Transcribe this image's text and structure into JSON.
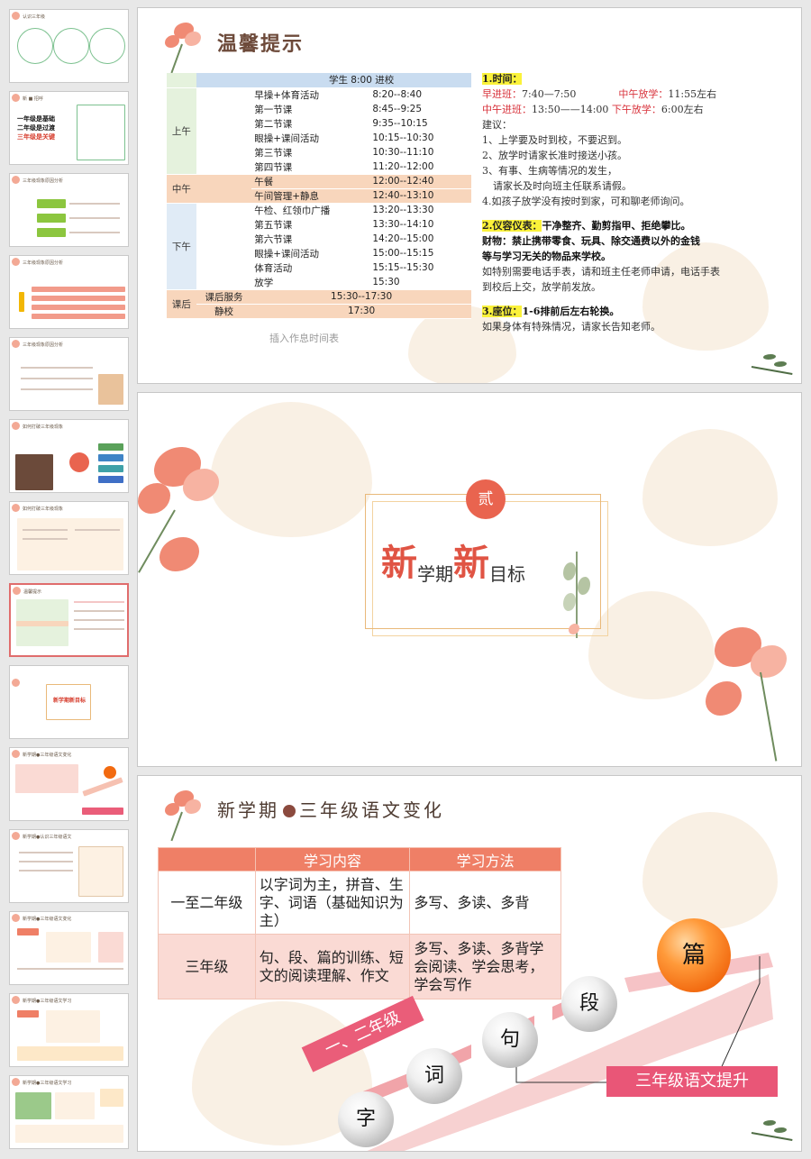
{
  "thumbnails": [
    {
      "title": "认识三年级",
      "lines": [
        "学习方法",
        "三年级的学习特点"
      ]
    },
    {
      "title": "新 ■ 招呼",
      "lines": [
        "一年级是基础",
        "二年级是过渡",
        "三年级是关键"
      ]
    },
    {
      "title": "三年级现象原因分析",
      "lines": [
        "学习内容难度逐渐提升"
      ]
    },
    {
      "title": "三年级现象原因分析",
      "lines": [
        "学习习惯，学习态度懒惰"
      ]
    },
    {
      "title": "三年级现象原因分析",
      "lines": [
        "缺乏兴趣"
      ]
    },
    {
      "title": "如何打破三年级现象",
      "lines": [
        "抓"
      ]
    },
    {
      "title": "如何打破三年级现象",
      "lines": [
        "三个关注"
      ]
    },
    {
      "title": "温馨提示",
      "lines": []
    },
    {
      "title": "",
      "lines": [
        "新学期新目标"
      ]
    },
    {
      "title": "新学期●三年级语文变化",
      "lines": []
    },
    {
      "title": "新学期●认识三年级语文",
      "lines": []
    },
    {
      "title": "新学期●三年级语文变化",
      "lines": []
    },
    {
      "title": "新学期●三年级语文学习",
      "lines": []
    },
    {
      "title": "新学期●三年级语文学习",
      "lines": []
    }
  ],
  "slide1": {
    "title": "温馨提示",
    "schedule_header": "学生 8:00 进校",
    "groups": {
      "am": "上午",
      "noon": "中午",
      "pm": "下午",
      "post": "课后"
    },
    "am_rows": [
      {
        "name": "早操+体育活动",
        "time": "8:20--8:40"
      },
      {
        "name": "第一节课",
        "time": "8:45--9:25"
      },
      {
        "name": "第二节课",
        "time": "9:35--10:15"
      },
      {
        "name": "眼操+课间活动",
        "time": "10:15--10:30"
      },
      {
        "name": "第三节课",
        "time": "10:30--11:10"
      },
      {
        "name": "第四节课",
        "time": "11:20--12:00"
      }
    ],
    "noon_rows": [
      {
        "name": "午餐",
        "time": "12:00--12:40"
      },
      {
        "name": "午间管理+静息",
        "time": "12:40--13:10"
      }
    ],
    "pm_rows": [
      {
        "name": "午检、红领巾广播",
        "time": "13:20--13:30"
      },
      {
        "name": "第五节课",
        "time": "13:30--14:10"
      },
      {
        "name": "第六节课",
        "time": "14:20--15:00"
      },
      {
        "name": "眼操+课间活动",
        "time": "15:00--15:15"
      },
      {
        "name": "体育活动",
        "time": "15:15--15:30"
      },
      {
        "name": "放学",
        "time": "15:30"
      }
    ],
    "post_rows": [
      {
        "name": "课后服务",
        "time": "15:30--17:30"
      },
      {
        "name": "静校",
        "time": "17:30"
      }
    ],
    "caption": "插入作息时间表",
    "notes": {
      "h1": "1.时间：",
      "early_label": "早进班：",
      "early_time": "7:40—7:50",
      "noon_out_label": "中午放学：",
      "noon_out_time": "11:55左右",
      "noon_in_label": "中午进班：",
      "noon_in_time": "13:50——14:00",
      "pm_out_label": "下午放学：",
      "pm_out_time": "6:00左右",
      "advice": "建议：",
      "a1": "1、上学要及时到校，不要迟到。",
      "a2": "2、放学时请家长准时接送小孩。",
      "a3": "3、有事、生病等情况的发生，",
      "a3b": "请家长及时向班主任联系请假。",
      "a4": "4.如孩子放学没有按时到家，可和聊老师询问。",
      "h2": "2.仪容仪表：",
      "h2_text": "干净整齐、勤剪指甲、拒绝攀比。",
      "p1": "财物：禁止携带零食、玩具、除交通费以外的金钱",
      "p2": "等与学习无关的物品来学校。",
      "p3": "如特别需要电话手表，请和班主任老师申请，电话手表",
      "p4": "到校后上交，放学前发放。",
      "h3": "3.座位：",
      "h3_text": "1-6排前后左右轮换。",
      "p5": "如果身体有特殊情况，请家长告知老师。"
    }
  },
  "slide2": {
    "number": "贰",
    "goal_a": "新",
    "goal_b": "学期",
    "goal_c": "新",
    "goal_d": "目标"
  },
  "slide3": {
    "title_a": "新学期",
    "title_b": "三年级语文变化",
    "table": {
      "headers": [
        "",
        "学习内容",
        "学习方法"
      ],
      "rows": [
        {
          "grade": "一至二年级",
          "content": "以字词为主，拼音、生字、词语（基础知识为主）",
          "method": "多写、多读、多背"
        },
        {
          "grade": "三年级",
          "content": "句、段、篇的训练、短文的阅读理解、作文",
          "method": "多写、多读、多背学会阅读、学会思考，学会写作"
        }
      ]
    },
    "balls": [
      "字",
      "词",
      "句",
      "段",
      "篇"
    ],
    "banner_left": "一、二年级",
    "banner_right": "三年级语文提升"
  }
}
